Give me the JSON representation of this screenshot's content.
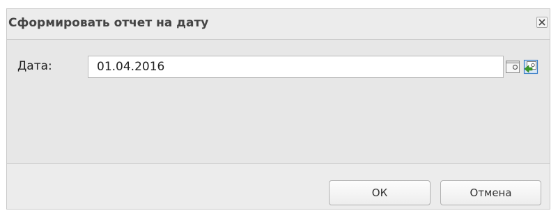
{
  "dialog": {
    "title": "Сформировать отчет на дату",
    "close_icon": "close-icon"
  },
  "form": {
    "date_label": "Дата:",
    "date_value": "01.04.2016",
    "calendar_icon": "calendar-icon",
    "today_icon": "today-icon"
  },
  "buttons": {
    "ok_label": "ОК",
    "cancel_label": "Отмена"
  },
  "colors": {
    "dialog_bg": "#ececec",
    "panel_bg": "#e7e7e7",
    "title_text": "#444444",
    "accent_green": "#3a9b2a",
    "accent_blue": "#3a7fc9"
  }
}
